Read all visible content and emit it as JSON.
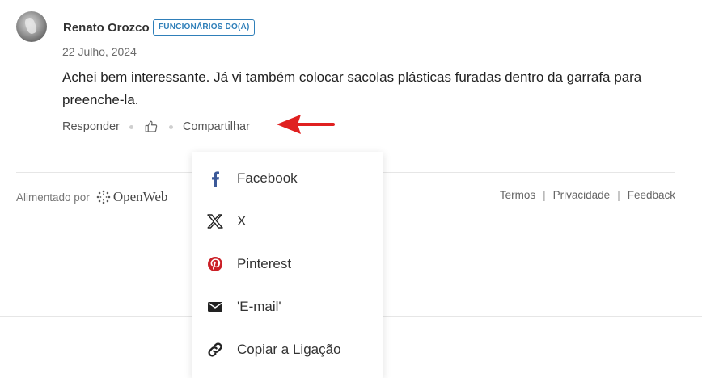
{
  "comment": {
    "author": "Renato Orozco",
    "badge": "FUNCIONÁRIOS DO(A)",
    "date": "22 Julho, 2024",
    "text": "Achei bem interessante. Já vi também colocar sacolas plásticas furadas dentro da garrafa para preenche-la.",
    "actions": {
      "reply": "Responder",
      "share": "Compartilhar"
    }
  },
  "footer": {
    "powered_by": "Alimentado por",
    "brand": "OpenWeb",
    "links": [
      "Termos",
      "Privacidade",
      "Feedback"
    ]
  },
  "share_menu": {
    "items": [
      {
        "label": "Facebook",
        "icon": "facebook-icon",
        "color": "#3b5998"
      },
      {
        "label": "X",
        "icon": "x-icon",
        "color": "#222222"
      },
      {
        "label": "Pinterest",
        "icon": "pinterest-icon",
        "color": "#cb2027"
      },
      {
        "label": "'E-mail'",
        "icon": "email-icon",
        "color": "#222222"
      },
      {
        "label": "Copiar a Ligação",
        "icon": "link-icon",
        "color": "#222222"
      }
    ]
  },
  "colors": {
    "badge": "#2f7fb9",
    "annotation_arrow": "#e02020"
  }
}
